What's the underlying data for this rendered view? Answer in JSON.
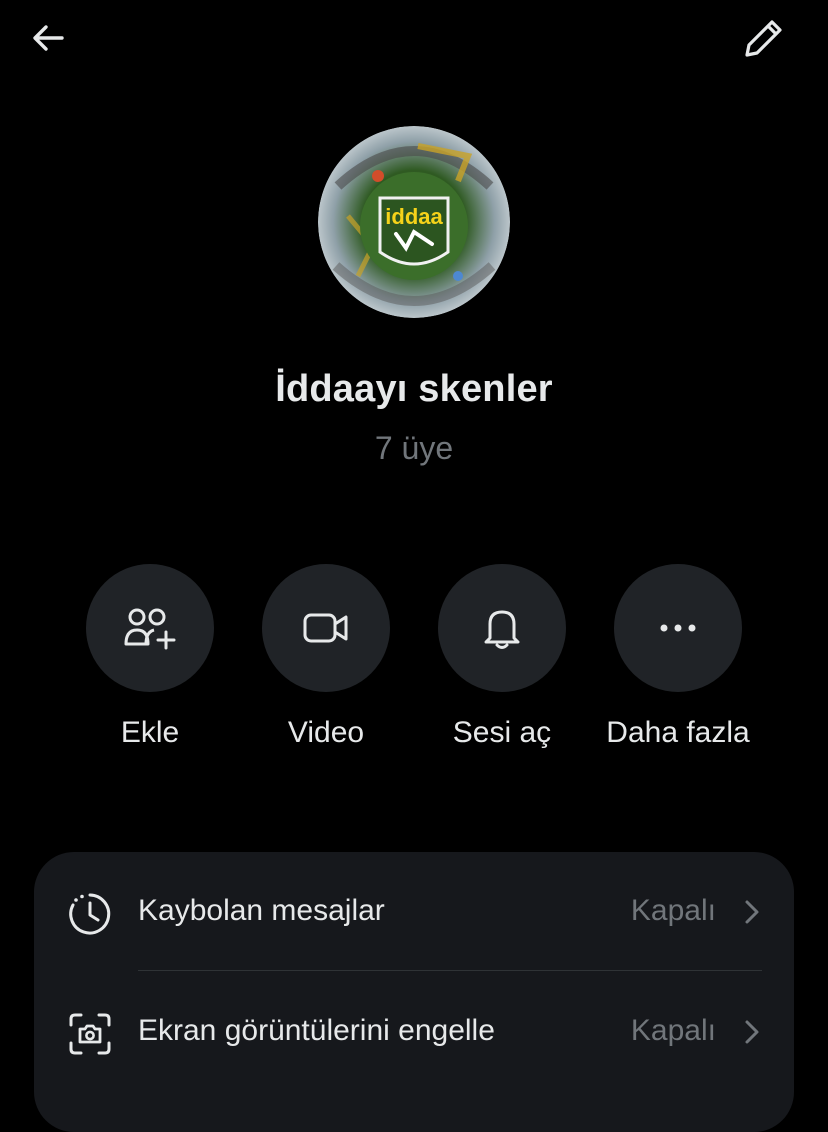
{
  "header": {
    "back_icon": "arrow-left-icon",
    "edit_icon": "pencil-icon"
  },
  "group": {
    "avatar_caption": "iddaa",
    "name": "İddaayı skenler",
    "members": "7 üye"
  },
  "actions": [
    {
      "label": "Ekle",
      "icon": "add-people-icon"
    },
    {
      "label": "Video",
      "icon": "video-camera-icon"
    },
    {
      "label": "Sesi aç",
      "icon": "bell-icon"
    },
    {
      "label": "Daha fazla",
      "icon": "more-dots-icon"
    }
  ],
  "settings": [
    {
      "label": "Kaybolan mesajlar",
      "value": "Kapalı",
      "icon": "timer-icon"
    },
    {
      "label": "Ekran görüntülerini engelle",
      "value": "Kapalı",
      "icon": "screenshot-camera-icon"
    }
  ],
  "colors": {
    "background": "#000000",
    "primary_text": "#e7e9ea",
    "secondary_text": "#71767b",
    "circle_button": "#202327",
    "card": "#16181c"
  }
}
